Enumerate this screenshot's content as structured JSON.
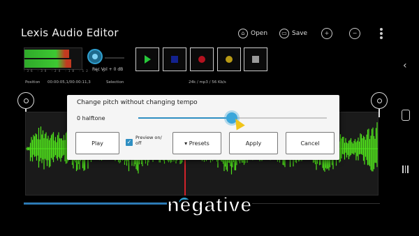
{
  "app": {
    "title": "Lexis Audio Editor"
  },
  "toolbar": {
    "open_label": "Open",
    "save_label": "Save",
    "zoom_in_icon": "zoom-in-icon",
    "zoom_out_icon": "zoom-out-icon",
    "menu_icon": "more-vert-icon"
  },
  "meter": {
    "scale": "-36 -30 -24 -18 -12 -6 0",
    "level_top": 0.78,
    "level_bottom": 0.82
  },
  "rec_volume": {
    "label": "Rec Vol + 0 dB"
  },
  "transport": {
    "buttons": [
      "play",
      "stop",
      "record",
      "pause",
      "square"
    ],
    "colors": {
      "play": "#27c83a",
      "stop": "#13228f",
      "record": "#b3121f",
      "pause": "#b89a15",
      "square": "#9a9a9a"
    }
  },
  "info": {
    "position_label": "Position",
    "position_value": "00:00:05,1/00:00:11,3",
    "selection_label": "Selection",
    "format": "24k / mp3 / 56 Kb/s"
  },
  "playback": {
    "progress": 0.43
  },
  "dialog": {
    "title": "Change pitch without changing tempo",
    "value": "0 halftone",
    "slider_fraction": 0.5,
    "buttons": {
      "play": "Play",
      "preview": "Preview on/ off",
      "presets": "▾ Presets",
      "apply": "Apply",
      "cancel": "Cancel"
    },
    "preview_checked": true
  },
  "caption": "negative",
  "colors": {
    "accent": "#2f8fc2",
    "waveform": "#4fe31b",
    "playhead": "#d2232a"
  }
}
